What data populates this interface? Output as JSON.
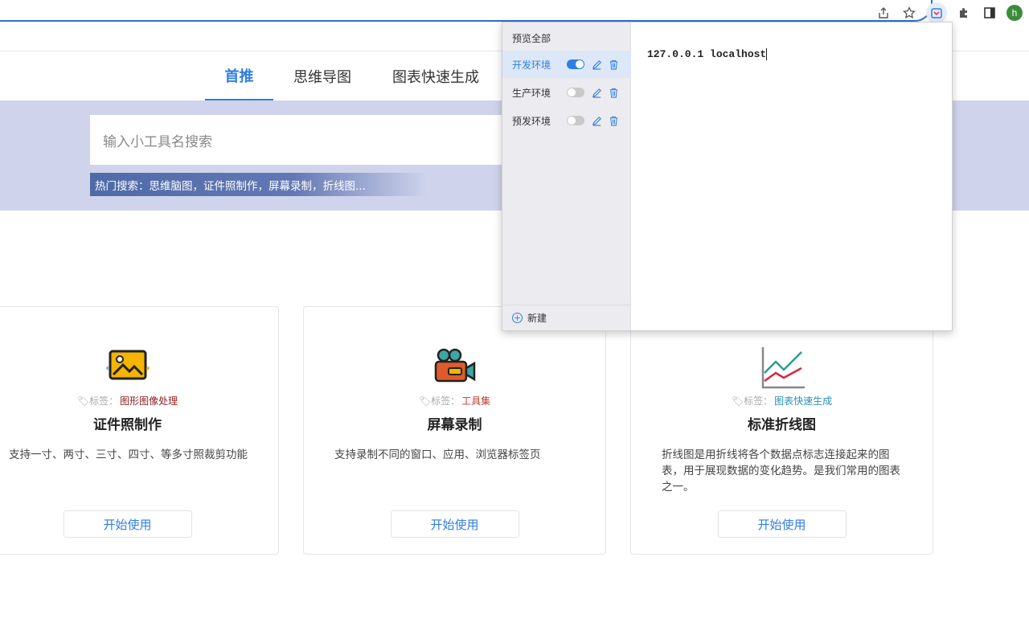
{
  "browser": {
    "avatar_letter": "h"
  },
  "nav": {
    "tabs": [
      {
        "label": "首推"
      },
      {
        "label": "思维导图"
      },
      {
        "label": "图表快速生成"
      }
    ]
  },
  "search": {
    "placeholder": "输入小工具名搜索",
    "hot_label": "热门搜索：思维脑图，证件照制作，屏幕录制，折线图..."
  },
  "cards": [
    {
      "tag_prefix": "标签：",
      "tag": "图形图像处理",
      "tag_color": "#8b1a1a",
      "title": "证件照制作",
      "desc": "支持一寸、两寸、三寸、四寸、等多寸照裁剪功能",
      "button": "开始使用"
    },
    {
      "tag_prefix": "标签：",
      "tag": "工具集",
      "tag_color": "#c0392b",
      "title": "屏幕录制",
      "desc": "支持录制不同的窗口、应用、浏览器标签页",
      "button": "开始使用"
    },
    {
      "tag_prefix": "标签：",
      "tag": "图表快速生成",
      "tag_color": "#2a8fbd",
      "title": "标准折线图",
      "desc": "折线图是用折线将各个数据点标志连接起来的图表，用于展现数据的变化趋势。是我们常用的图表之一。",
      "button": "开始使用"
    }
  ],
  "popup": {
    "preview_all": "预览全部",
    "envs": [
      {
        "label": "开发环境",
        "enabled": true
      },
      {
        "label": "生产环境",
        "enabled": false
      },
      {
        "label": "预发环境",
        "enabled": false
      }
    ],
    "new_label": "新建",
    "editor_text": "127.0.0.1 localhost"
  },
  "colors": {
    "accent": "#2f7ee0",
    "search_band": "#cfd4ec"
  }
}
